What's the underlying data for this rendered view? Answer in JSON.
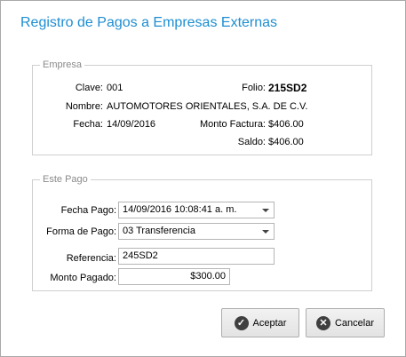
{
  "window": {
    "title": "Registro de Pagos a Empresas Externas"
  },
  "empresa": {
    "legend": "Empresa",
    "clave_label": "Clave:",
    "clave_value": "001",
    "folio_label": "Folio:",
    "folio_value": "215SD2",
    "nombre_label": "Nombre:",
    "nombre_value": "AUTOMOTORES ORIENTALES, S.A. DE C.V.",
    "fecha_label": "Fecha:",
    "fecha_value": "14/09/2016",
    "monto_factura_label": "Monto Factura:",
    "monto_factura_value": "$406.00",
    "saldo_label": "Saldo:",
    "saldo_value": "$406.00"
  },
  "pago": {
    "legend": "Este Pago",
    "fecha_pago_label": "Fecha Pago:",
    "fecha_pago_value": "14/09/2016 10:08:41 a. m.",
    "forma_pago_label": "Forma de Pago:",
    "forma_pago_value": "03 Transferencia",
    "referencia_label": "Referencia:",
    "referencia_value": "245SD2",
    "monto_pagado_label": "Monto Pagado:",
    "monto_pagado_value": "$300.00"
  },
  "buttons": {
    "aceptar": "Aceptar",
    "cancelar": "Cancelar"
  },
  "icons": {
    "aceptar": "check-circle-icon",
    "cancelar": "close-circle-icon"
  }
}
